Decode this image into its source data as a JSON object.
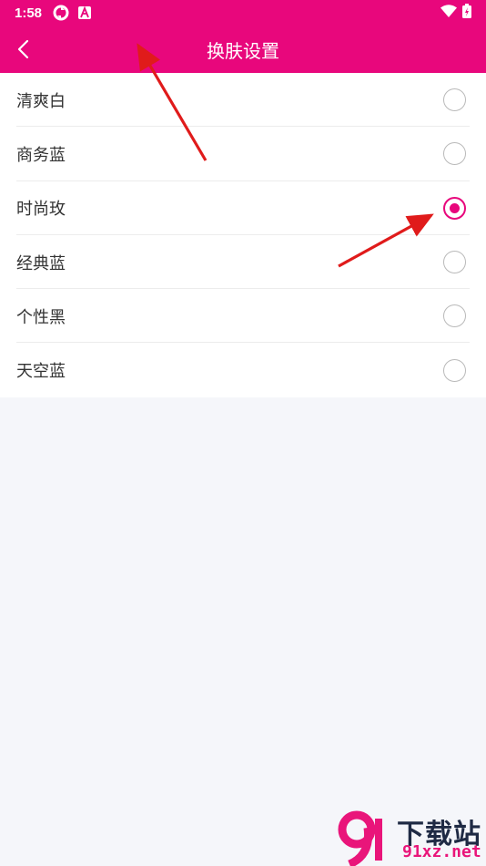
{
  "status_bar": {
    "time": "1:58",
    "left_icons": [
      "sync-icon",
      "font-a-icon"
    ],
    "right_icons": [
      "wifi-icon",
      "battery-charging-icon"
    ]
  },
  "toolbar": {
    "back_icon": "chevron-left-icon",
    "title": "换肤设置"
  },
  "colors": {
    "accent": "#e8077c",
    "background": "#f5f6fa",
    "annotation_arrow": "#e01b1b"
  },
  "skin_options": [
    {
      "label": "清爽白",
      "selected": false
    },
    {
      "label": "商务蓝",
      "selected": false
    },
    {
      "label": "时尚玫",
      "selected": true
    },
    {
      "label": "经典蓝",
      "selected": false
    },
    {
      "label": "个性黑",
      "selected": false
    },
    {
      "label": "天空蓝",
      "selected": false
    }
  ],
  "watermark": {
    "site_name": "下载站",
    "domain": "91xz.net"
  }
}
